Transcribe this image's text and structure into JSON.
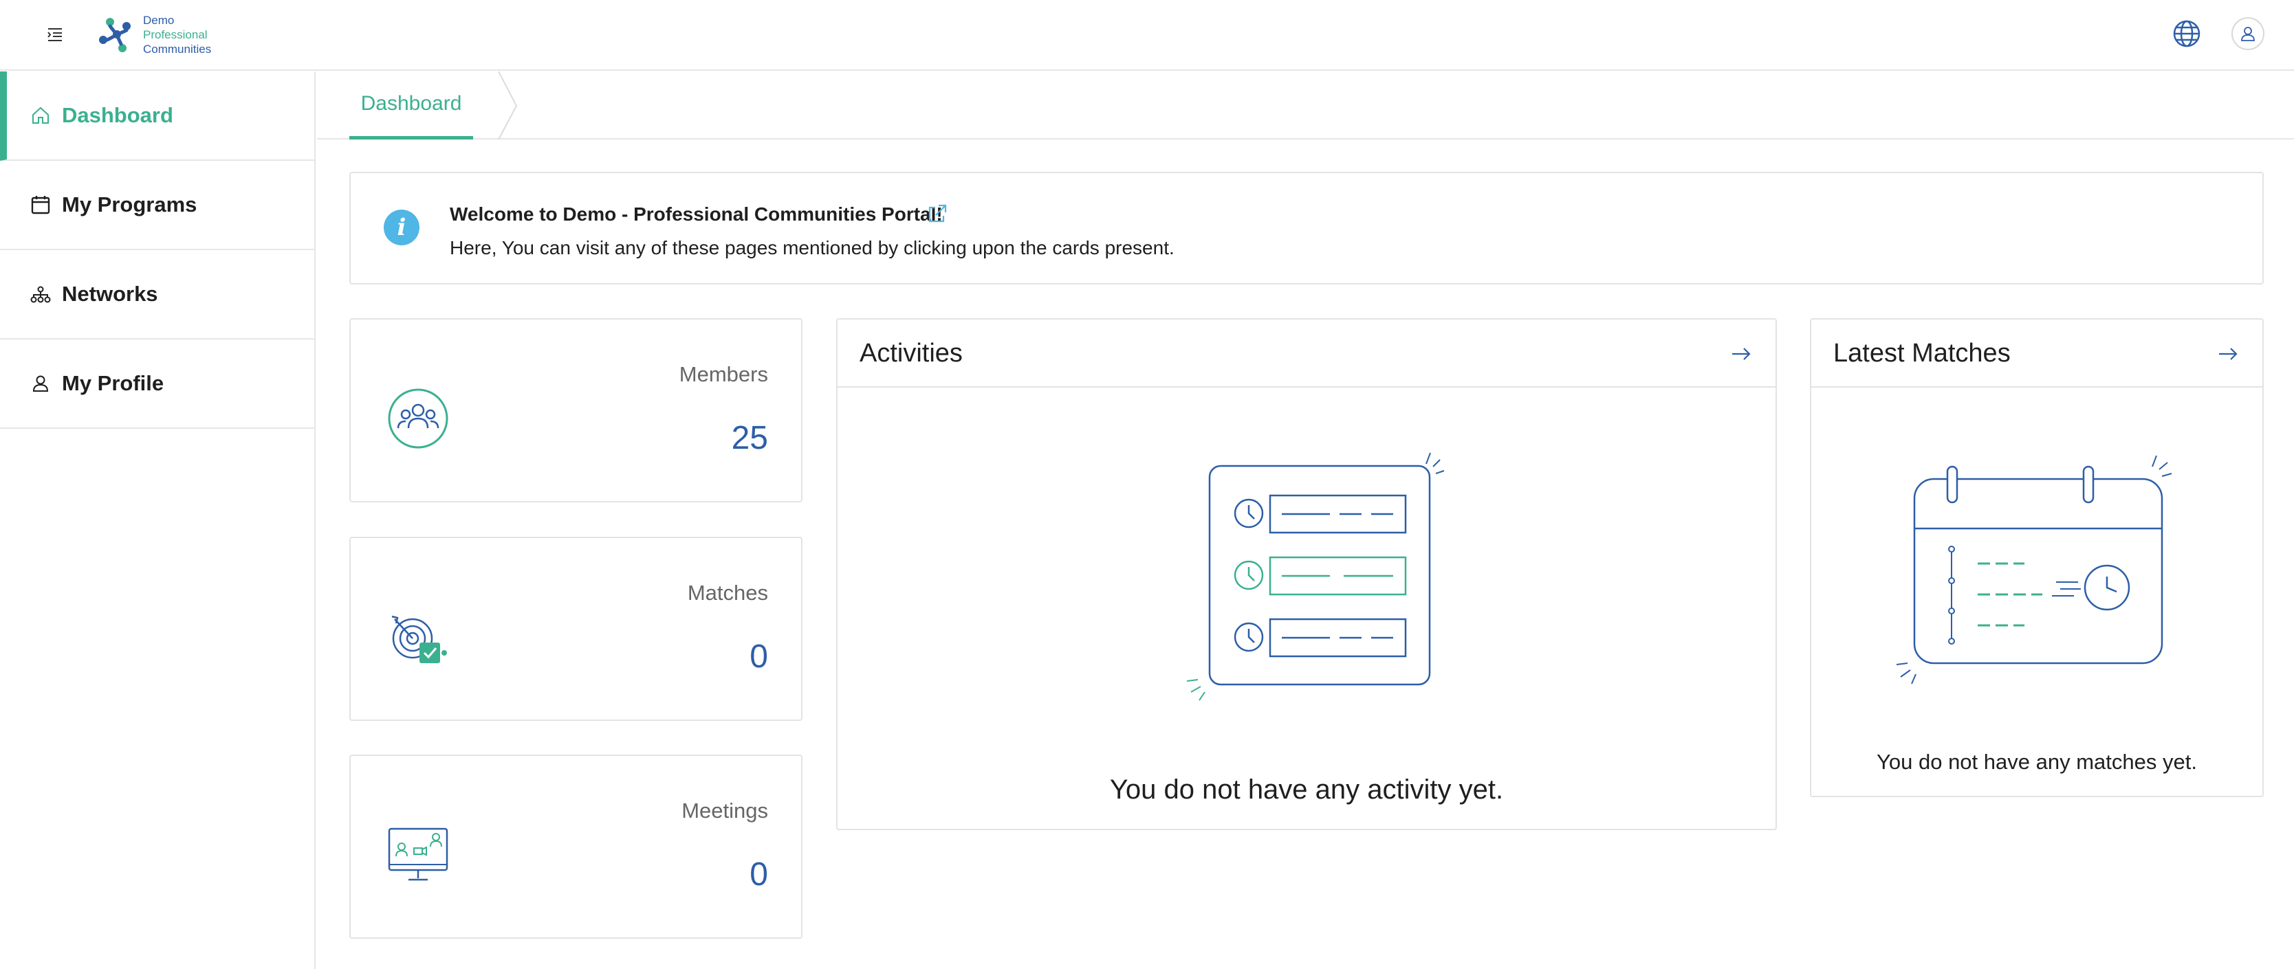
{
  "header": {
    "logo": {
      "line1": "Demo",
      "line2": "Professional",
      "line3": "Communities"
    },
    "menu_icon": "menu-collapse-icon",
    "language_icon": "globe-icon",
    "user_icon": "user-icon"
  },
  "sidebar": {
    "items": [
      {
        "label": "Dashboard",
        "icon": "home-icon",
        "active": true
      },
      {
        "label": "My Programs",
        "icon": "calendar-icon",
        "active": false
      },
      {
        "label": "Networks",
        "icon": "network-icon",
        "active": false
      },
      {
        "label": "My Profile",
        "icon": "user-icon",
        "active": false
      }
    ]
  },
  "breadcrumb": {
    "current": "Dashboard"
  },
  "welcome": {
    "title": "Welcome to Demo - Professional Communities Portal!",
    "description": "Here, You can visit any of these pages mentioned by clicking upon the cards present."
  },
  "stats": [
    {
      "label": "Members",
      "value": "25",
      "icon": "members-icon"
    },
    {
      "label": "Matches",
      "value": "0",
      "icon": "target-icon"
    },
    {
      "label": "Meetings",
      "value": "0",
      "icon": "meeting-monitor-icon"
    }
  ],
  "activities": {
    "title": "Activities",
    "empty_text": "You do not have any activity yet."
  },
  "matches_panel": {
    "title": "Latest Matches",
    "empty_text": "You do not have any matches yet."
  },
  "colors": {
    "accent_green": "#3bb08f",
    "accent_blue": "#2d5ea8",
    "info_blue": "#4fb6e5",
    "border": "#e3e3e3"
  }
}
